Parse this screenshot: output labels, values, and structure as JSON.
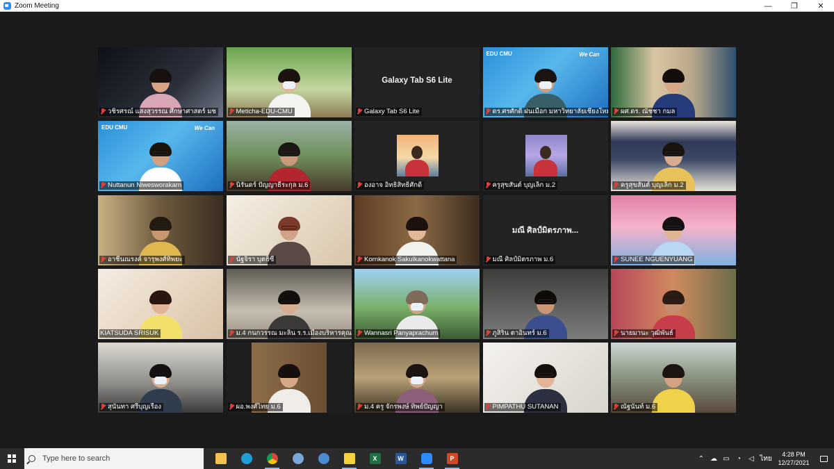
{
  "window": {
    "title": "Zoom Meeting",
    "controls": [
      "—",
      "❐",
      "✕"
    ]
  },
  "colors": {
    "active_speaker_border": "#c8e04a",
    "muted_mic": "#e0403a",
    "stage_bg": "#1a1a1a",
    "taskbar_bg": "#2b2b2b"
  },
  "participants": [
    {
      "name": "วชิรศรณ์ แสงสุวรรณ ศึกษาศาสตร์ มช",
      "muted": true,
      "video": true
    },
    {
      "name": "Meticha-EDU-CMU",
      "muted": true,
      "video": true
    },
    {
      "name": "Galaxy Tab S6 Lite",
      "muted": true,
      "video": false,
      "display_text": "Galaxy Tab S6 Lite"
    },
    {
      "name": "ดร.ศรศักดิ์ ฝนเมือก มหาวิทยาลัยเชียงใหม่",
      "muted": true,
      "video": true,
      "active": true,
      "banner_logo": "EDU CMU",
      "banner_tag": "We Can"
    },
    {
      "name": "ผศ.ดร. ณัชชา กมล",
      "muted": true,
      "video": true
    },
    {
      "name": "Nuttanun Niwesworakarn",
      "muted": true,
      "video": true,
      "banner_logo": "EDU CMU",
      "banner_tag": "We Can"
    },
    {
      "name": "นิรันดร์ ปัญญาธีระกุล ม.6",
      "muted": true,
      "video": true
    },
    {
      "name": "องอาจ อิทธิสิทธิ์ศักดิ์",
      "muted": true,
      "video": false,
      "has_photo": true
    },
    {
      "name": "ครูสุขสันต์ บุญเล็ก ม.2",
      "muted": true,
      "video": false,
      "has_photo": true
    },
    {
      "name": "ครูสุขสันต์ บุญเล็ก ม.2",
      "muted": true,
      "video": true
    },
    {
      "name": "อาชีนณรงค์ จารุพงศ์ทิพยะ",
      "muted": true,
      "video": true
    },
    {
      "name": "นัฐจิรา บุตธิซี",
      "muted": true,
      "video": true
    },
    {
      "name": "Kornkanok Sakulkanokwattana",
      "muted": true,
      "video": true
    },
    {
      "name": "มณี ศิลป์มิตรภาพ ม.6",
      "muted": true,
      "video": false,
      "display_text": "มณี ศิลป์มิตรภาพ..."
    },
    {
      "name": "SUNEE NGUENYUANG",
      "muted": true,
      "video": true
    },
    {
      "name": "KIATSUDA SRISUK",
      "muted": false,
      "video": true
    },
    {
      "name": "ม.4 กนกวรรณ มะลิน ร.ร.เมืองบริหารคุณ",
      "muted": true,
      "video": true
    },
    {
      "name": "Wannasri Panyaprachum",
      "muted": true,
      "video": true
    },
    {
      "name": "ภูสิริน ตาอินทร์ ม.6",
      "muted": true,
      "video": true
    },
    {
      "name": "นายมานะ วุฒิพันธ์",
      "muted": true,
      "video": true
    },
    {
      "name": "สุนันทา ศรีบุญเรือง",
      "muted": true,
      "video": true
    },
    {
      "name": "ผอ.พงศ์ไทย ม.6",
      "muted": true,
      "video": true
    },
    {
      "name": "ม.4 ครู จักรพงษ์ ทิพย์ปัญญา",
      "muted": true,
      "video": true
    },
    {
      "name": "PIMPATHU SUTANAN",
      "muted": true,
      "video": true
    },
    {
      "name": "ณัฐนันท์ ม.6",
      "muted": true,
      "video": true
    }
  ],
  "taskbar": {
    "search_placeholder": "Type here to search",
    "apps": [
      {
        "name": "file-explorer",
        "glyph": ""
      },
      {
        "name": "edge",
        "glyph": ""
      },
      {
        "name": "chrome",
        "glyph": ""
      },
      {
        "name": "app-4",
        "glyph": ""
      },
      {
        "name": "app-5",
        "glyph": ""
      },
      {
        "name": "sticky-notes",
        "glyph": ""
      },
      {
        "name": "excel",
        "glyph": "X"
      },
      {
        "name": "word",
        "glyph": "W"
      },
      {
        "name": "zoom",
        "glyph": ""
      },
      {
        "name": "powerpoint",
        "glyph": "P"
      }
    ],
    "language": "ไทย",
    "time": "4:28 PM",
    "date": "12/27/2021"
  }
}
